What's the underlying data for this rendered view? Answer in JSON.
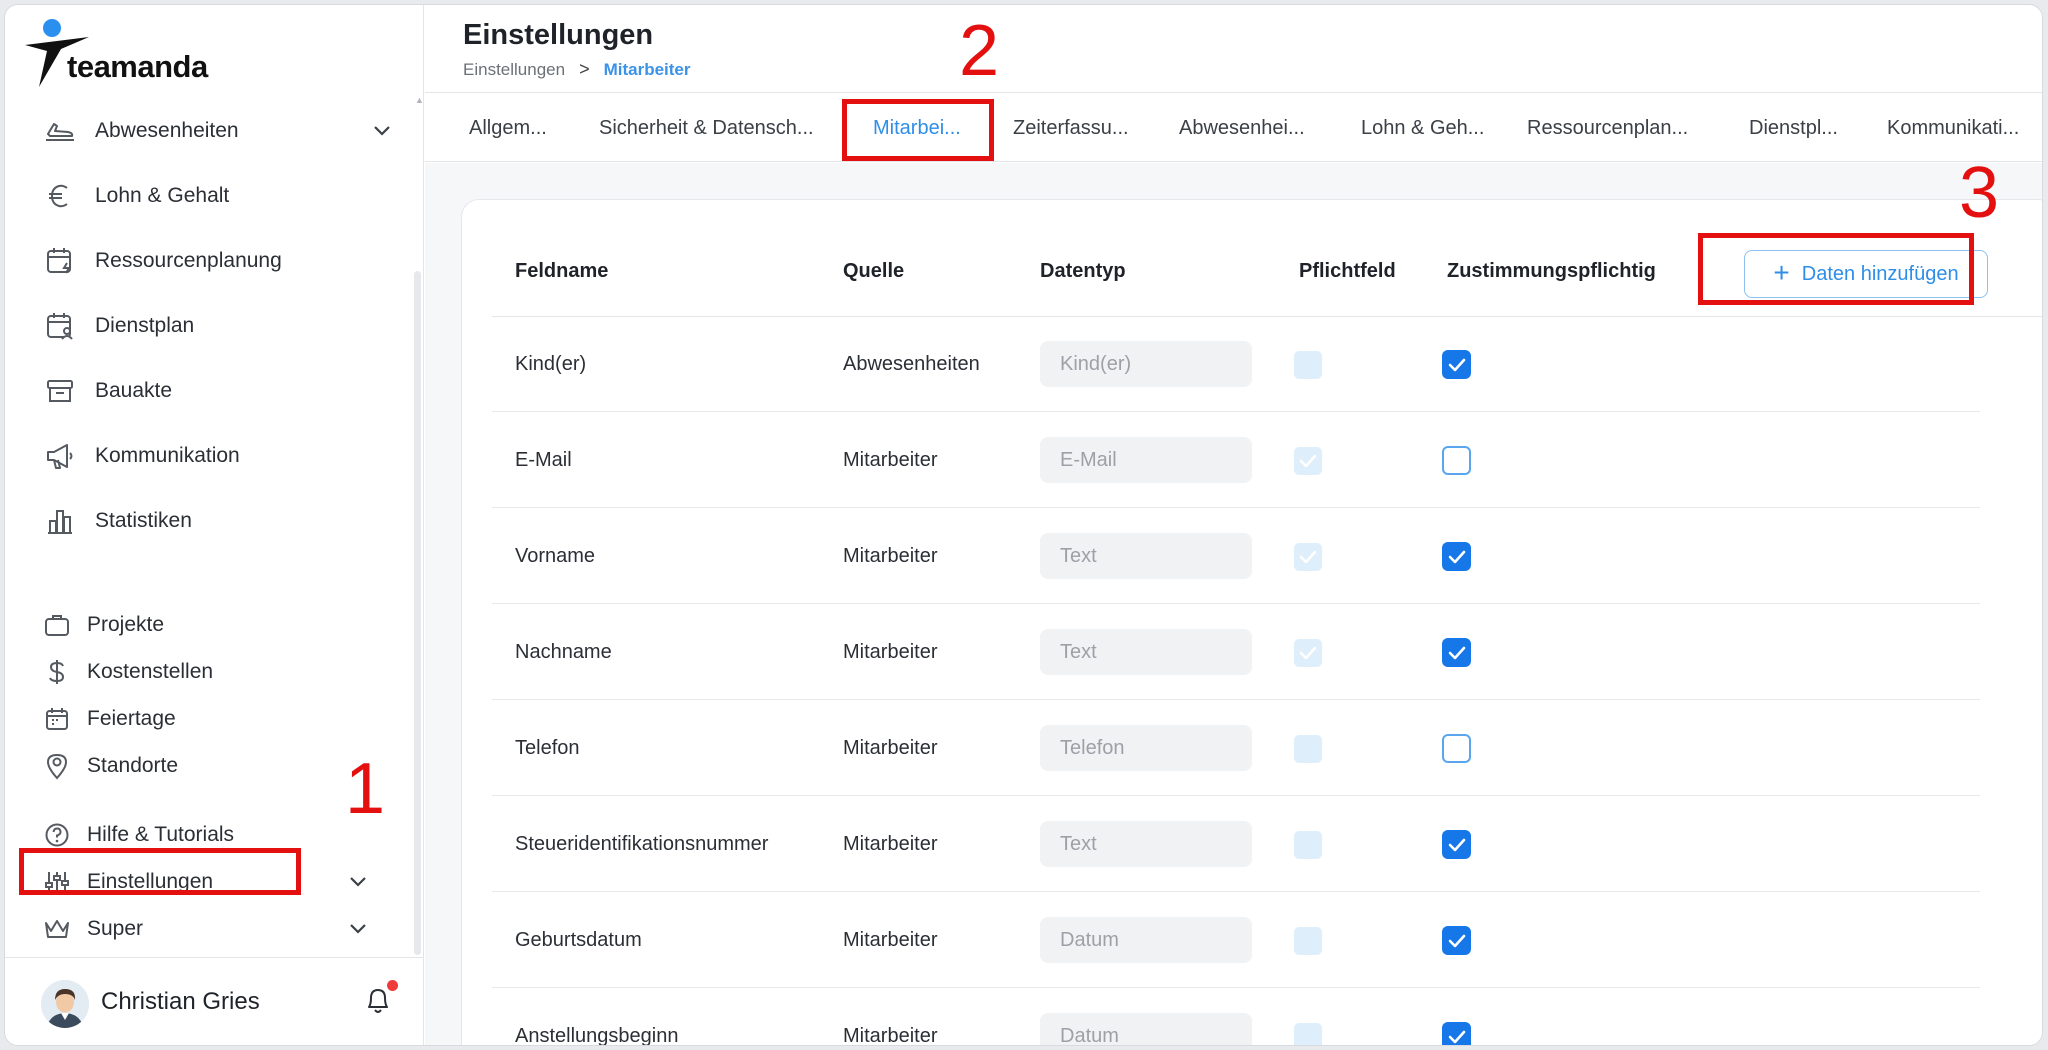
{
  "app": {
    "name": "teamanda"
  },
  "sidebar": {
    "items": [
      {
        "label": "Abwesenheiten",
        "icon": "plane-icon",
        "has_chevron": true
      },
      {
        "label": "Lohn & Gehalt",
        "icon": "euro-icon"
      },
      {
        "label": "Ressourcenplanung",
        "icon": "calendar-bolt-icon"
      },
      {
        "label": "Dienstplan",
        "icon": "calendar-user-icon"
      },
      {
        "label": "Bauakte",
        "icon": "archive-icon"
      },
      {
        "label": "Kommunikation",
        "icon": "megaphone-icon"
      },
      {
        "label": "Statistiken",
        "icon": "bar-chart-icon"
      }
    ],
    "secondary_items": [
      {
        "label": "Projekte",
        "icon": "briefcase-icon"
      },
      {
        "label": "Kostenstellen",
        "icon": "dollar-icon"
      },
      {
        "label": "Feiertage",
        "icon": "calendar-icon"
      },
      {
        "label": "Standorte",
        "icon": "location-pin-icon"
      },
      {
        "label": "Hilfe & Tutorials",
        "icon": "help-circle-icon"
      },
      {
        "label": "Einstellungen",
        "icon": "sliders-icon",
        "has_chevron": true
      },
      {
        "label": "Super",
        "icon": "crown-icon",
        "has_chevron": true
      }
    ],
    "user": {
      "name": "Christian Gries",
      "notification_dot_color": "#f03b3b"
    }
  },
  "header": {
    "title": "Einstellungen",
    "breadcrumb": [
      "Einstellungen",
      "Mitarbeiter"
    ]
  },
  "tabs": [
    {
      "label": "Allgem..."
    },
    {
      "label": "Sicherheit & Datensch..."
    },
    {
      "label": "Mitarbei...",
      "active": true
    },
    {
      "label": "Zeiterfassu..."
    },
    {
      "label": "Abwesenhei..."
    },
    {
      "label": "Lohn & Geh..."
    },
    {
      "label": "Ressourcenplan..."
    },
    {
      "label": "Dienstpl..."
    },
    {
      "label": "Kommunikati..."
    }
  ],
  "table": {
    "columns": [
      "Feldname",
      "Quelle",
      "Datentyp",
      "Pflichtfeld",
      "Zustimmungspflichtig"
    ],
    "add_button": "Daten hinzufügen",
    "rows": [
      {
        "feldname": "Kind(er)",
        "quelle": "Abwesenheiten",
        "datentyp": "Kind(er)",
        "pflichtfeld": false,
        "zustimmung": true
      },
      {
        "feldname": "E-Mail",
        "quelle": "Mitarbeiter",
        "datentyp": "E-Mail",
        "pflichtfeld": true,
        "zustimmung": false
      },
      {
        "feldname": "Vorname",
        "quelle": "Mitarbeiter",
        "datentyp": "Text",
        "pflichtfeld": true,
        "zustimmung": true
      },
      {
        "feldname": "Nachname",
        "quelle": "Mitarbeiter",
        "datentyp": "Text",
        "pflichtfeld": true,
        "zustimmung": true
      },
      {
        "feldname": "Telefon",
        "quelle": "Mitarbeiter",
        "datentyp": "Telefon",
        "pflichtfeld": false,
        "zustimmung": false
      },
      {
        "feldname": "Steueridentifikationsnummer",
        "quelle": "Mitarbeiter",
        "datentyp": "Text",
        "pflichtfeld": false,
        "zustimmung": true
      },
      {
        "feldname": "Geburtsdatum",
        "quelle": "Mitarbeiter",
        "datentyp": "Datum",
        "pflichtfeld": false,
        "zustimmung": true
      },
      {
        "feldname": "Anstellungsbeginn",
        "quelle": "Mitarbeiter",
        "datentyp": "Datum",
        "pflichtfeld": false,
        "zustimmung": true
      }
    ]
  },
  "annotations": [
    "1",
    "2",
    "3"
  ],
  "colors": {
    "accent": "#2e8ee8",
    "checkbox_on": "#1677e8",
    "annotation": "#e41010"
  }
}
